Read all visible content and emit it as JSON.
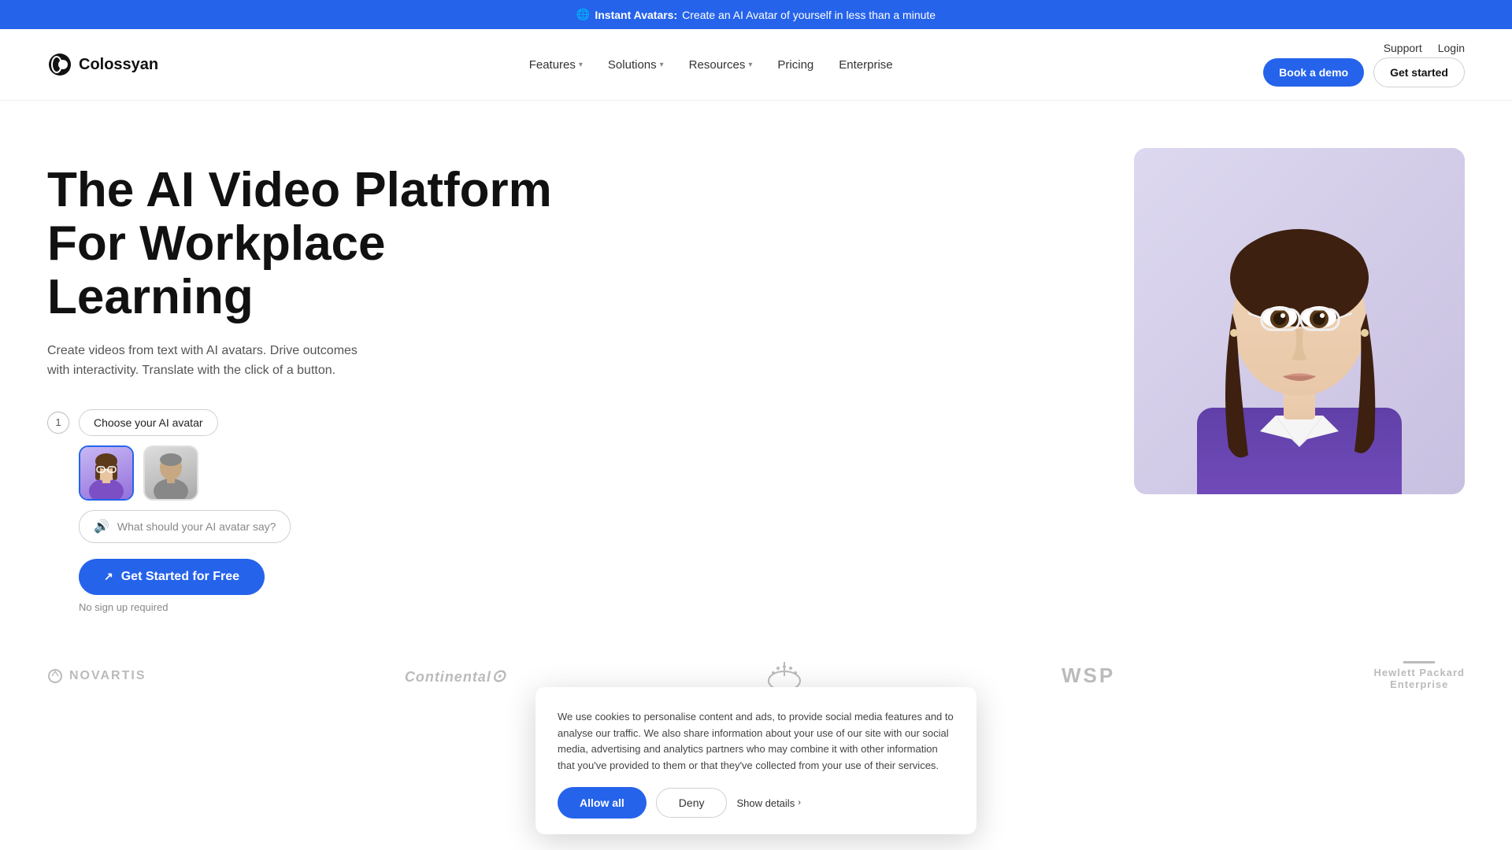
{
  "banner": {
    "emoji": "🌐",
    "highlight": "Instant Avatars:",
    "text": "Create an AI Avatar of yourself in less than a minute"
  },
  "nav": {
    "logo_text": "Colossyan",
    "util_links": [
      {
        "label": "Support",
        "href": "#"
      },
      {
        "label": "Login",
        "href": "#"
      }
    ],
    "links": [
      {
        "label": "Features",
        "has_dropdown": true
      },
      {
        "label": "Solutions",
        "has_dropdown": true
      },
      {
        "label": "Resources",
        "has_dropdown": true
      },
      {
        "label": "Pricing",
        "has_dropdown": false
      },
      {
        "label": "Enterprise",
        "has_dropdown": false
      }
    ],
    "book_demo_label": "Book a demo",
    "get_started_label": "Get started"
  },
  "hero": {
    "title_line1": "The AI Video Platform",
    "title_line2": "For Workplace Learning",
    "subtitle": "Create videos from text with AI avatars. Drive outcomes with interactivity. Translate with the click of a button.",
    "step1_number": "1",
    "step1_label": "Choose your AI avatar",
    "step2_placeholder": "What should your AI avatar say?",
    "cta_label": "Get Started for Free",
    "no_signup": "No sign up required"
  },
  "logos": [
    {
      "name": "Novartis"
    },
    {
      "name": "Continental"
    },
    {
      "name": "Paramount"
    },
    {
      "name": "WSP"
    },
    {
      "name": "Hewlett Packard Enterprise"
    }
  ],
  "cookie": {
    "text": "We use cookies to personalise content and ads, to provide social media features and to analyse our traffic. We also share information about your use of our site with our social media, advertising and analytics partners who may combine it with other information that you've provided to them or that they've collected from your use of their services.",
    "show_details_label": "Show details",
    "allow_all_label": "Allow all",
    "deny_label": "Deny"
  }
}
